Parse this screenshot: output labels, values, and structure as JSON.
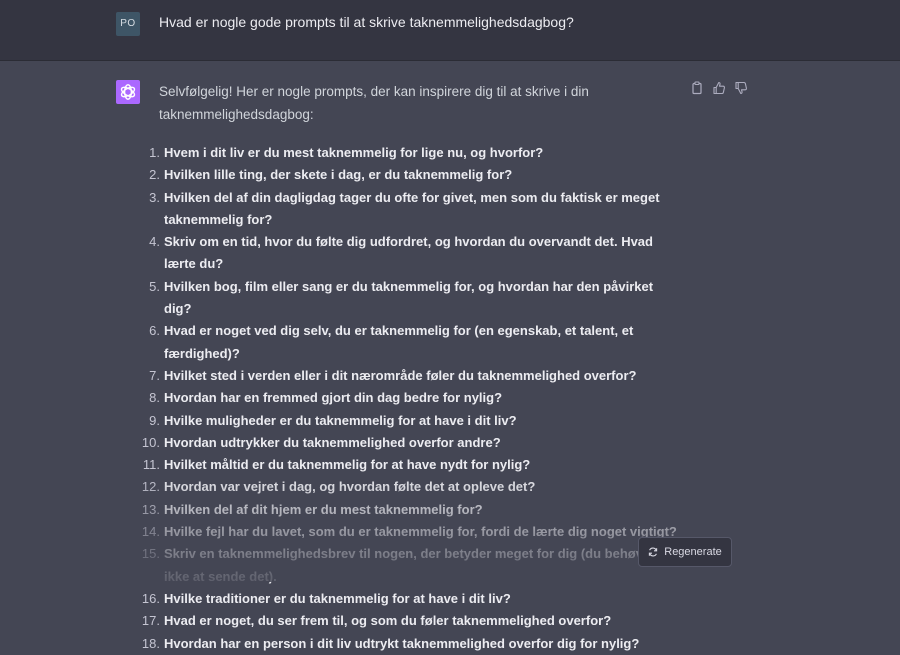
{
  "user_message": {
    "avatar_initials": "PO",
    "text": "Hvad er nogle gode prompts til at skrive taknemmelighedsdagbog?"
  },
  "assistant_message": {
    "intro": "Selvfølgelig! Her er nogle prompts, der kan inspirere dig til at skrive i din taknemmelighedsdagbog:",
    "actions": [
      "copy-icon",
      "thumbs-up-icon",
      "thumbs-down-icon"
    ],
    "items": [
      {
        "num": "1.",
        "text": "Hvem i dit liv er du mest taknemmelig for lige nu, og hvorfor?"
      },
      {
        "num": "2.",
        "text": "Hvilken lille ting, der skete i dag, er du taknemmelig for?"
      },
      {
        "num": "3.",
        "text": "Hvilken del af din dagligdag tager du ofte for givet, men som du faktisk er meget taknemmelig for?"
      },
      {
        "num": "4.",
        "text": "Skriv om en tid, hvor du følte dig udfordret, og hvordan du overvandt det. Hvad lærte du?"
      },
      {
        "num": "5.",
        "text": "Hvilken bog, film eller sang er du taknemmelig for, og hvordan har den påvirket dig?"
      },
      {
        "num": "6.",
        "text": "Hvad er noget ved dig selv, du er taknemmelig for (en egenskab, et talent, et færdighed)?"
      },
      {
        "num": "7.",
        "text": "Hvilket sted i verden eller i dit nærområde føler du taknemmelighed overfor?"
      },
      {
        "num": "8.",
        "text": "Hvordan har en fremmed gjort din dag bedre for nylig?"
      },
      {
        "num": "9.",
        "text": "Hvilke muligheder er du taknemmelig for at have i dit liv?"
      },
      {
        "num": "10.",
        "text": "Hvordan udtrykker du taknemmelighed overfor andre?"
      },
      {
        "num": "11.",
        "text": "Hvilket måltid er du taknemmelig for at have nydt for nylig?"
      },
      {
        "num": "12.",
        "text": "Hvordan var vejret i dag, og hvordan følte det at opleve det?"
      },
      {
        "num": "13.",
        "text": "Hvilken del af dit hjem er du mest taknemmelig for?"
      },
      {
        "num": "14.",
        "text": "Hvilke fejl har du lavet, som du er taknemmelig for, fordi de lærte dig noget vigtigt?"
      },
      {
        "num": "15.",
        "text": "Skriv en taknemmelighedsbrev til nogen, der betyder meget for dig (du behøver ikke at sende det)."
      },
      {
        "num": "16.",
        "text": "Hvilke traditioner er du taknemmelig for at have i dit liv?"
      },
      {
        "num": "17.",
        "text": "Hvad er noget, du ser frem til, og som du føler taknemmelighed overfor?"
      },
      {
        "num": "18.",
        "text": "Hvordan har en person i dit liv udtrykt taknemmelighed overfor dig for nylig?"
      }
    ]
  },
  "regenerate_button": {
    "label": "Regenerate",
    "icon": "refresh-icon"
  },
  "colors": {
    "page": "#444654",
    "user_row": "#343541",
    "bot_avatar": "#ab68ff"
  }
}
